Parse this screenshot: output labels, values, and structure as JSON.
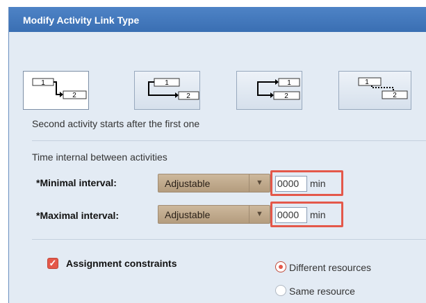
{
  "dialog": {
    "title": "Modify Activity Link Type",
    "link_types": [
      {
        "name": "finish-to-start",
        "box1": "1",
        "box2": "2",
        "selected": true
      },
      {
        "name": "start-to-start",
        "box1": "1",
        "box2": "2",
        "selected": false
      },
      {
        "name": "finish-to-finish",
        "box1": "1",
        "box2": "2",
        "selected": false
      },
      {
        "name": "start-to-finish",
        "box1": "1",
        "box2": "2",
        "selected": false
      }
    ],
    "description": "Second activity starts after the first one",
    "interval_section_title": "Time internal between activities",
    "minimal": {
      "label": "*Minimal interval:",
      "mode": "Adjustable",
      "value": "0000",
      "unit": "min"
    },
    "maximal": {
      "label": "*Maximal interval:",
      "mode": "Adjustable",
      "value": "0000",
      "unit": "min"
    },
    "dropdown_arrow_icon": "triangle-down",
    "assignment": {
      "label": "Assignment constraints",
      "checked": true
    },
    "resources": [
      {
        "label": "Different resources",
        "selected": true
      },
      {
        "label": "Same resource",
        "selected": false
      }
    ],
    "colors": {
      "title_bar": "#3a6fb3",
      "accent": "#e4584a",
      "body": "#e3ebf4",
      "select": "#c2ab8d"
    }
  }
}
